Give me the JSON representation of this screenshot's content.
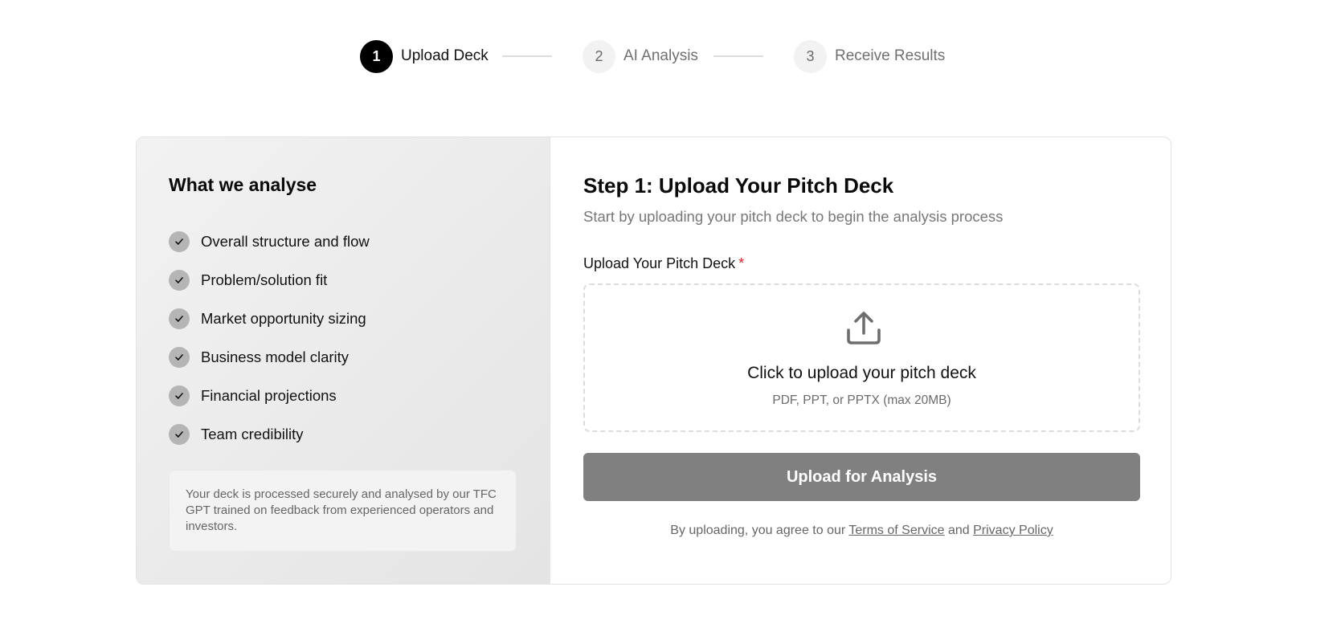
{
  "stepper": {
    "steps": [
      {
        "number": "1",
        "label": "Upload Deck",
        "state": "active"
      },
      {
        "number": "2",
        "label": "AI Analysis",
        "state": "inactive"
      },
      {
        "number": "3",
        "label": "Receive Results",
        "state": "inactive"
      }
    ]
  },
  "sidebar": {
    "title": "What we analyse",
    "items": [
      "Overall structure and flow",
      "Problem/solution fit",
      "Market opportunity sizing",
      "Business model clarity",
      "Financial projections",
      "Team credibility"
    ],
    "note": "Your deck is processed securely and analysed by our TFC GPT trained on feedback from experienced operators and investors."
  },
  "main": {
    "title": "Step 1: Upload Your Pitch Deck",
    "subtitle": "Start by uploading your pitch deck to begin the analysis process",
    "upload_label": "Upload Your Pitch Deck",
    "required_mark": "*",
    "dropzone": {
      "icon": "upload-icon",
      "title": "Click to upload your pitch deck",
      "hint": "PDF, PPT, or PPTX (max 20MB)"
    },
    "submit_label": "Upload for Analysis",
    "terms": {
      "prefix": "By uploading, you agree to our",
      "terms_link": "Terms of Service",
      "and": "and",
      "privacy_link": "Privacy Policy"
    }
  },
  "colors": {
    "active_step": "#000000",
    "button": "#808080",
    "required": "#e02424"
  }
}
